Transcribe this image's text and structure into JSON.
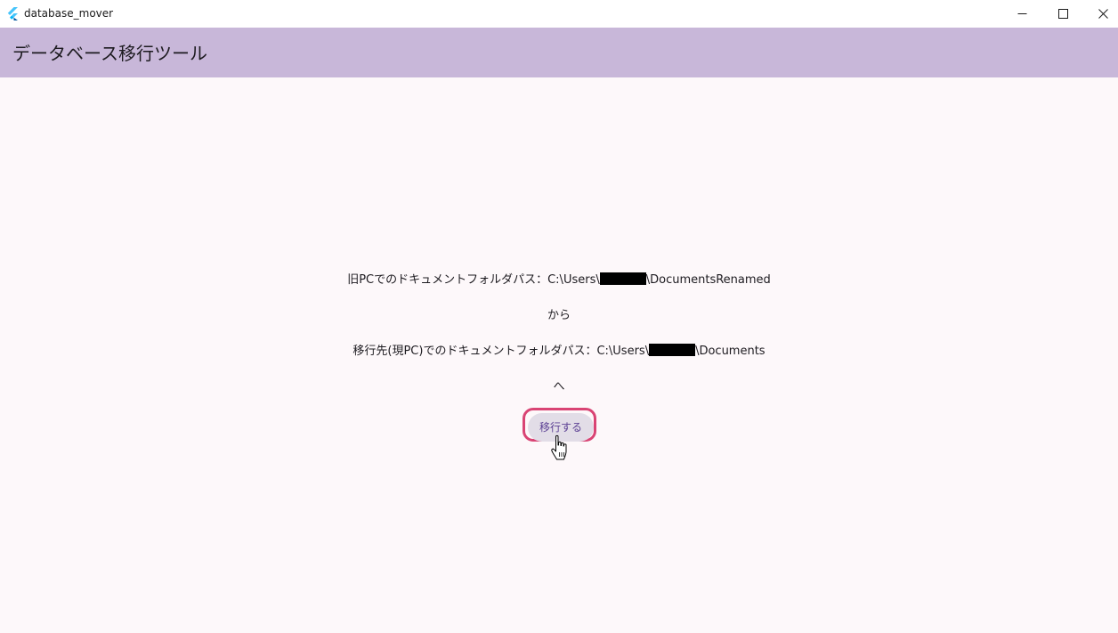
{
  "window": {
    "title": "database_mover",
    "icon": "flutter-logo-icon",
    "controls": [
      "minimize-icon",
      "maximize-icon",
      "close-icon"
    ]
  },
  "appbar": {
    "title": "データベース移行ツール"
  },
  "main": {
    "source_prefix": "旧PCでのドキュメントフォルダパス：C:\\Users\\",
    "source_suffix": "\\DocumentsRenamed",
    "from_label": "から",
    "dest_prefix": "移行先(現PC)でのドキュメントフォルダパス：C:\\Users\\",
    "dest_suffix": "\\Documents",
    "to_label": "へ",
    "migrate_button": "移行する"
  },
  "colors": {
    "appbar": "#c8b7d9",
    "background": "#fdf8fa",
    "button_bg": "#e2dde7",
    "button_text": "#5b3f93",
    "highlight": "#d94474"
  }
}
